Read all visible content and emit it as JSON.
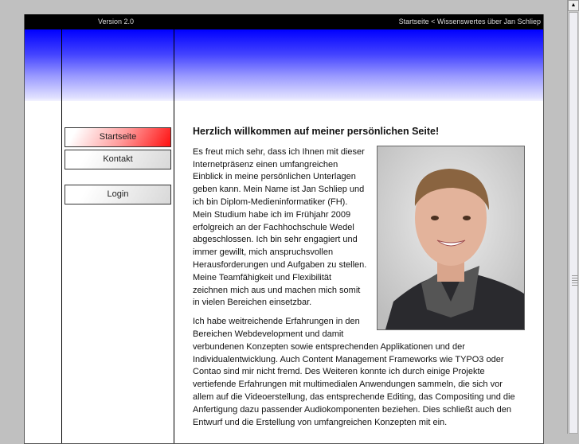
{
  "header": {
    "version": "Version 2.0",
    "breadcrumb": "Startseite < Wissenswertes über Jan Schliep"
  },
  "nav": {
    "startseite": "Startseite",
    "kontakt": "Kontakt",
    "login": "Login"
  },
  "content": {
    "heading": "Herzlich willkommen auf meiner persönlichen Seite!",
    "paragraph1": "Es freut mich sehr, dass ich Ihnen mit dieser Internetpräsenz einen umfangreichen Einblick in meine persönlichen Unterlagen geben kann. Mein Name ist Jan Schliep und ich bin Diplom-Medieninformatiker (FH). Mein Studium habe ich im Frühjahr 2009 erfolgreich an der Fachhochschule Wedel abgeschlossen. Ich bin sehr engagiert und immer gewillt, mich anspruchsvollen Herausforderungen und Aufgaben zu stellen. Meine Teamfähigkeit und Flexibilität zeichnen mich aus und machen mich somit in vielen Bereichen einsetzbar.",
    "paragraph2": "Ich habe weitreichende Erfahrungen in den Bereichen Webdevelopment und damit verbundenen Konzepten sowie entsprechenden Applikationen und der Individualentwicklung. Auch Content Management Frameworks wie TYPO3 oder Contao sind mir nicht fremd. Des Weiteren konnte ich durch einige Projekte vertiefende Erfahrungen mit multimedialen Anwendungen sammeln, die sich vor allem auf die Videoerstellung, das entsprechende Editing, das Compositing und die Anfertigung dazu passender Audiokomponenten beziehen. Dies schließt auch den Entwurf und die Erstellung von umfangreichen Konzepten mit ein."
  }
}
